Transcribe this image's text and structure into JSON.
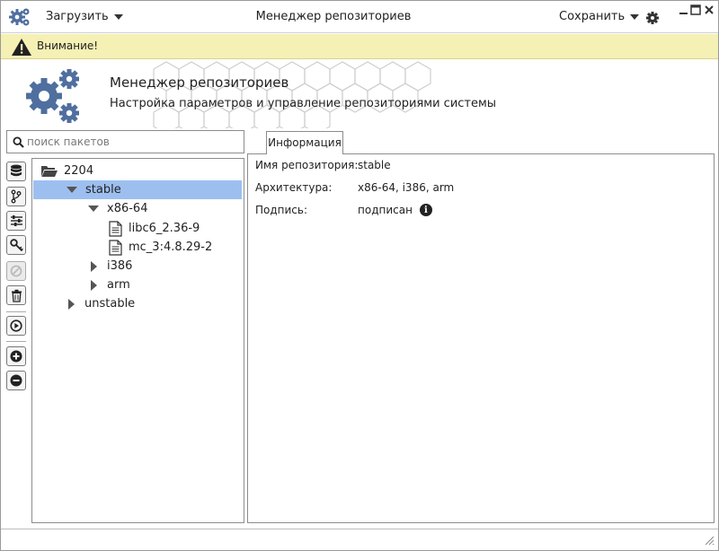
{
  "titlebar": {
    "load_label": "Загрузить",
    "title": "Менеджер репозиториев",
    "save_label": "Сохранить"
  },
  "warning": {
    "text": "Внимание!",
    "color": "#f5f0b4"
  },
  "header": {
    "title": "Менеджер репозиториев",
    "subtitle": "Настройка параметров и управление репозиториями системы",
    "accent": "#4f6f9f"
  },
  "search": {
    "placeholder": "поиск пакетов",
    "value": ""
  },
  "toolbar": {
    "buttons": [
      {
        "name": "database-icon"
      },
      {
        "name": "branch-icon"
      },
      {
        "name": "sliders-icon"
      },
      {
        "name": "key-icon"
      },
      {
        "name": "ban-icon",
        "disabled": true
      },
      {
        "name": "trash-icon"
      },
      {
        "name": "play-icon"
      },
      {
        "name": "plus-icon"
      },
      {
        "name": "minus-icon"
      }
    ]
  },
  "tree": {
    "root": "2204",
    "selected": "stable",
    "items": [
      {
        "label": "2204",
        "icon": "folder-open-icon"
      },
      {
        "label": "stable",
        "icon": "triangle-down"
      },
      {
        "label": "x86-64",
        "icon": "triangle-down"
      },
      {
        "label": "libc6_2.36-9",
        "icon": "file-icon"
      },
      {
        "label": "mc_3:4.8.29-2",
        "icon": "file-icon"
      },
      {
        "label": "i386",
        "icon": "triangle-right"
      },
      {
        "label": "arm",
        "icon": "triangle-right"
      },
      {
        "label": "unstable",
        "icon": "triangle-right"
      }
    ]
  },
  "tabs": [
    {
      "label": "Информация",
      "active": true
    }
  ],
  "info": {
    "rows": [
      {
        "label": "Имя репозитория:",
        "value": "stable"
      },
      {
        "label": "Архитектура:",
        "value": "x86-64, i386, arm"
      },
      {
        "label": "Подпись:",
        "value": "подписан",
        "icon": "info-icon"
      }
    ],
    "info_glyph": "i"
  },
  "colors": {
    "selection": "#9dbff0",
    "border": "#8c8c8c"
  }
}
